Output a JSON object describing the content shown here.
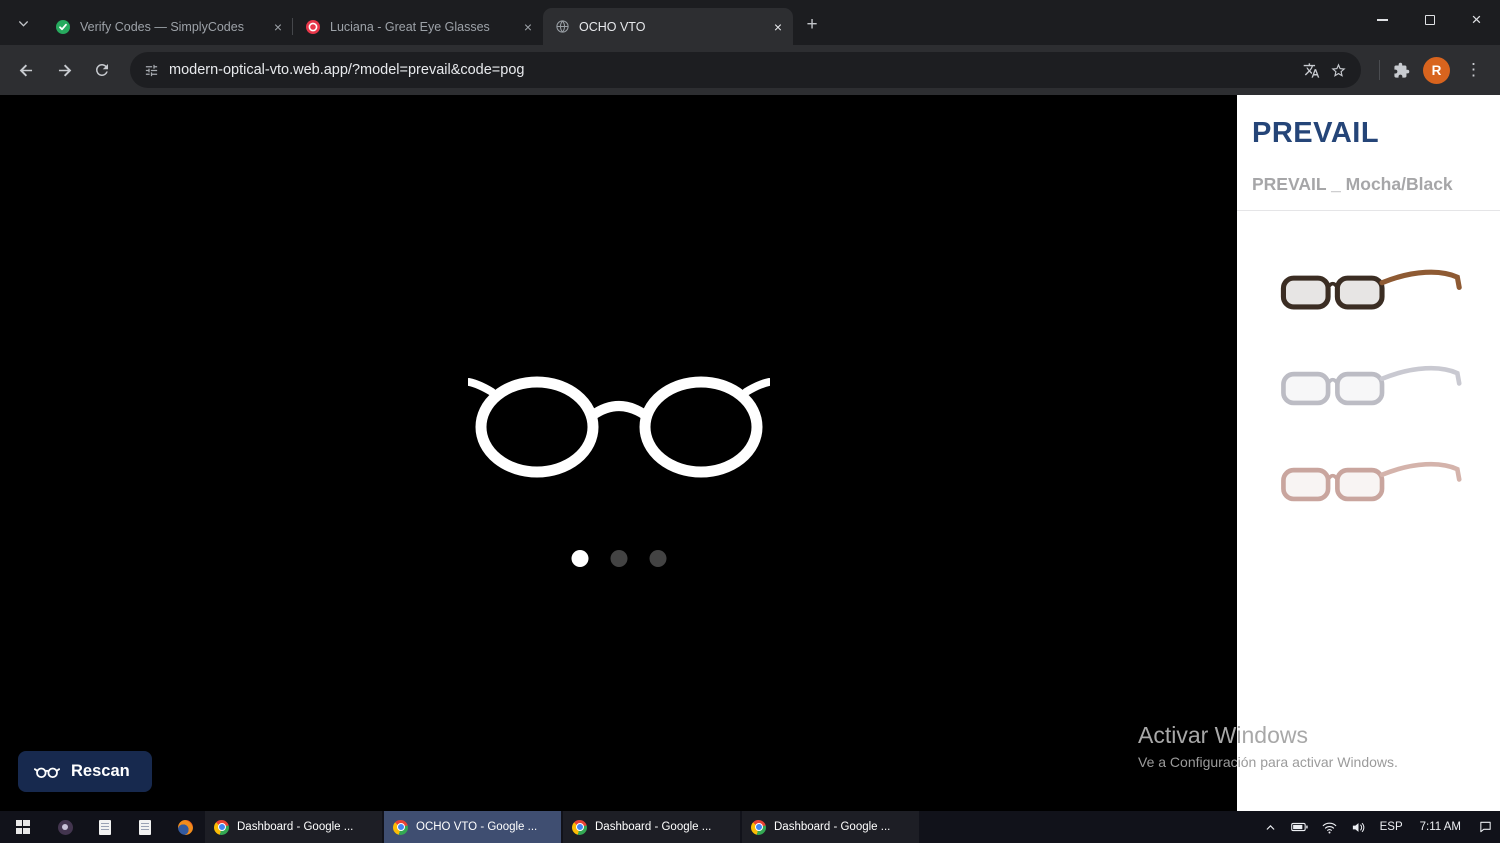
{
  "browser": {
    "tabs": [
      {
        "title": "Verify Codes — SimplyCodes"
      },
      {
        "title": "Luciana - Great Eye Glasses"
      },
      {
        "title": "OCHO VTO"
      }
    ],
    "url": "modern-optical-vto.web.app/?model=prevail&code=pog",
    "avatar_initial": "R"
  },
  "icons": {
    "new_tab": "+",
    "close": "×",
    "kebab": "⋮"
  },
  "app": {
    "rescan_label": "Rescan",
    "carousel": {
      "dot_count": 3,
      "active_index": 0
    }
  },
  "sidebar": {
    "title": "PREVAIL",
    "subtitle": "PREVAIL _ Mocha/Black",
    "thumbnails": [
      {
        "front": "#3b2d23",
        "temple": "#8e5a33"
      },
      {
        "front": "#bcbcc4",
        "temple": "#c9c9d1"
      },
      {
        "front": "#c9a59e",
        "temple": "#d4b3ab"
      }
    ]
  },
  "watermark": {
    "line1": "Activar Windows",
    "line2": "Ve a Configuración para activar Windows."
  },
  "taskbar": {
    "buttons": [
      {
        "label": "Dashboard - Google ..."
      },
      {
        "label": "OCHO VTO - Google ..."
      },
      {
        "label": "Dashboard - Google ..."
      },
      {
        "label": "Dashboard - Google ..."
      }
    ],
    "language": "ESP",
    "time": "7:11 AM"
  },
  "colors": {
    "rescan_navy": "#17294e",
    "title_blue": "#254578",
    "taskbar_active": "#3f4e71"
  }
}
